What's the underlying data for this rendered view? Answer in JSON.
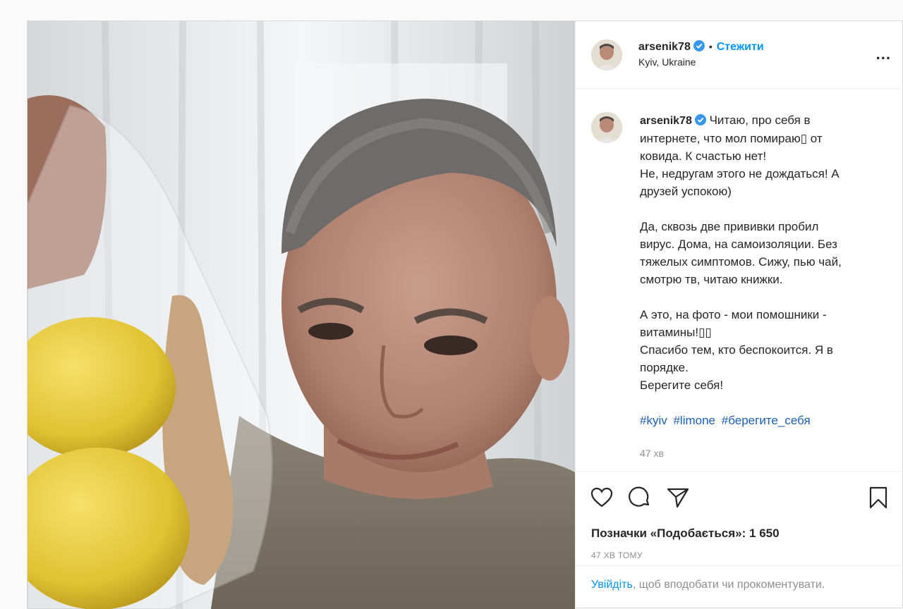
{
  "post": {
    "username": "arsenik78",
    "follow_label": "Стежити",
    "dot": "•",
    "location": "Kyiv, Ukraine",
    "more_label": "...",
    "caption_lines": [
      "Читаю, про себя в",
      "интернете, что мол помираю▯ от",
      "ковида. К счастью нет!",
      "Не, недругам этого не дождаться! А",
      "друзей успокою)",
      "",
      "Да, сквозь две прививки пробил",
      "вирус. Дома, на самоизоляции. Без",
      "тяжелых симптомов. Сижу, пью чай,",
      "смотрю тв, читаю книжки.",
      "",
      "А это, на фото - мои помошники -",
      "витамины!▯▯",
      "Спасибо тем, кто беспокоится. Я в",
      "порядке.",
      "Берегите себя!"
    ],
    "hashtags": [
      "#kyiv",
      "#limone",
      "#берегите_себя"
    ],
    "comment_time": "47 хв",
    "likes_text": "Позначки «Подобається»: 1 650",
    "posted_ago": "47 ХВ ТОМУ",
    "login_link": "Увійдіть",
    "login_rest": ", щоб вподобати чи прокоментувати."
  },
  "icons": {
    "verified": "verified-badge-icon",
    "like": "heart-icon",
    "comment": "comment-bubble-icon",
    "share": "paper-plane-icon",
    "save": "bookmark-icon"
  },
  "colors": {
    "accent": "#0095f6",
    "text": "#262626",
    "muted": "#8e8e8e",
    "hashtag": "#1a5fb4",
    "border": "#dbdbdb"
  }
}
